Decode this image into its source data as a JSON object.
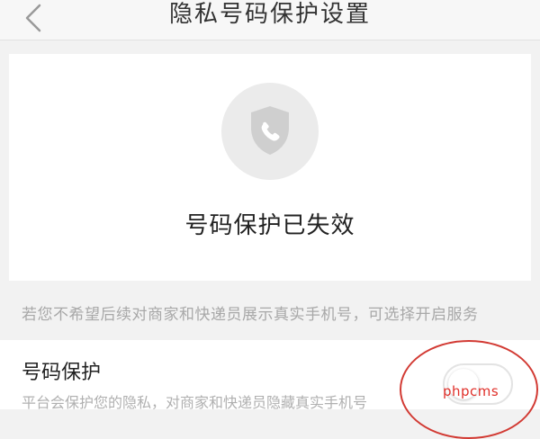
{
  "header": {
    "title": "隐私号码保护设置",
    "back_icon": "chevron-left-icon"
  },
  "status": {
    "icon": "shield-phone-icon",
    "text": "号码保护已失效"
  },
  "notice": {
    "text": "若您不希望后续对商家和快递员展示真实手机号，可选择开启服务"
  },
  "protection": {
    "title": "号码保护",
    "description": "平台会保护您的隐私，对商家和快递员隐藏真实手机号",
    "toggle_on": false
  },
  "watermark": "phpcms",
  "colors": {
    "annotation_red": "#d23a33",
    "background": "#f2f2f2"
  }
}
